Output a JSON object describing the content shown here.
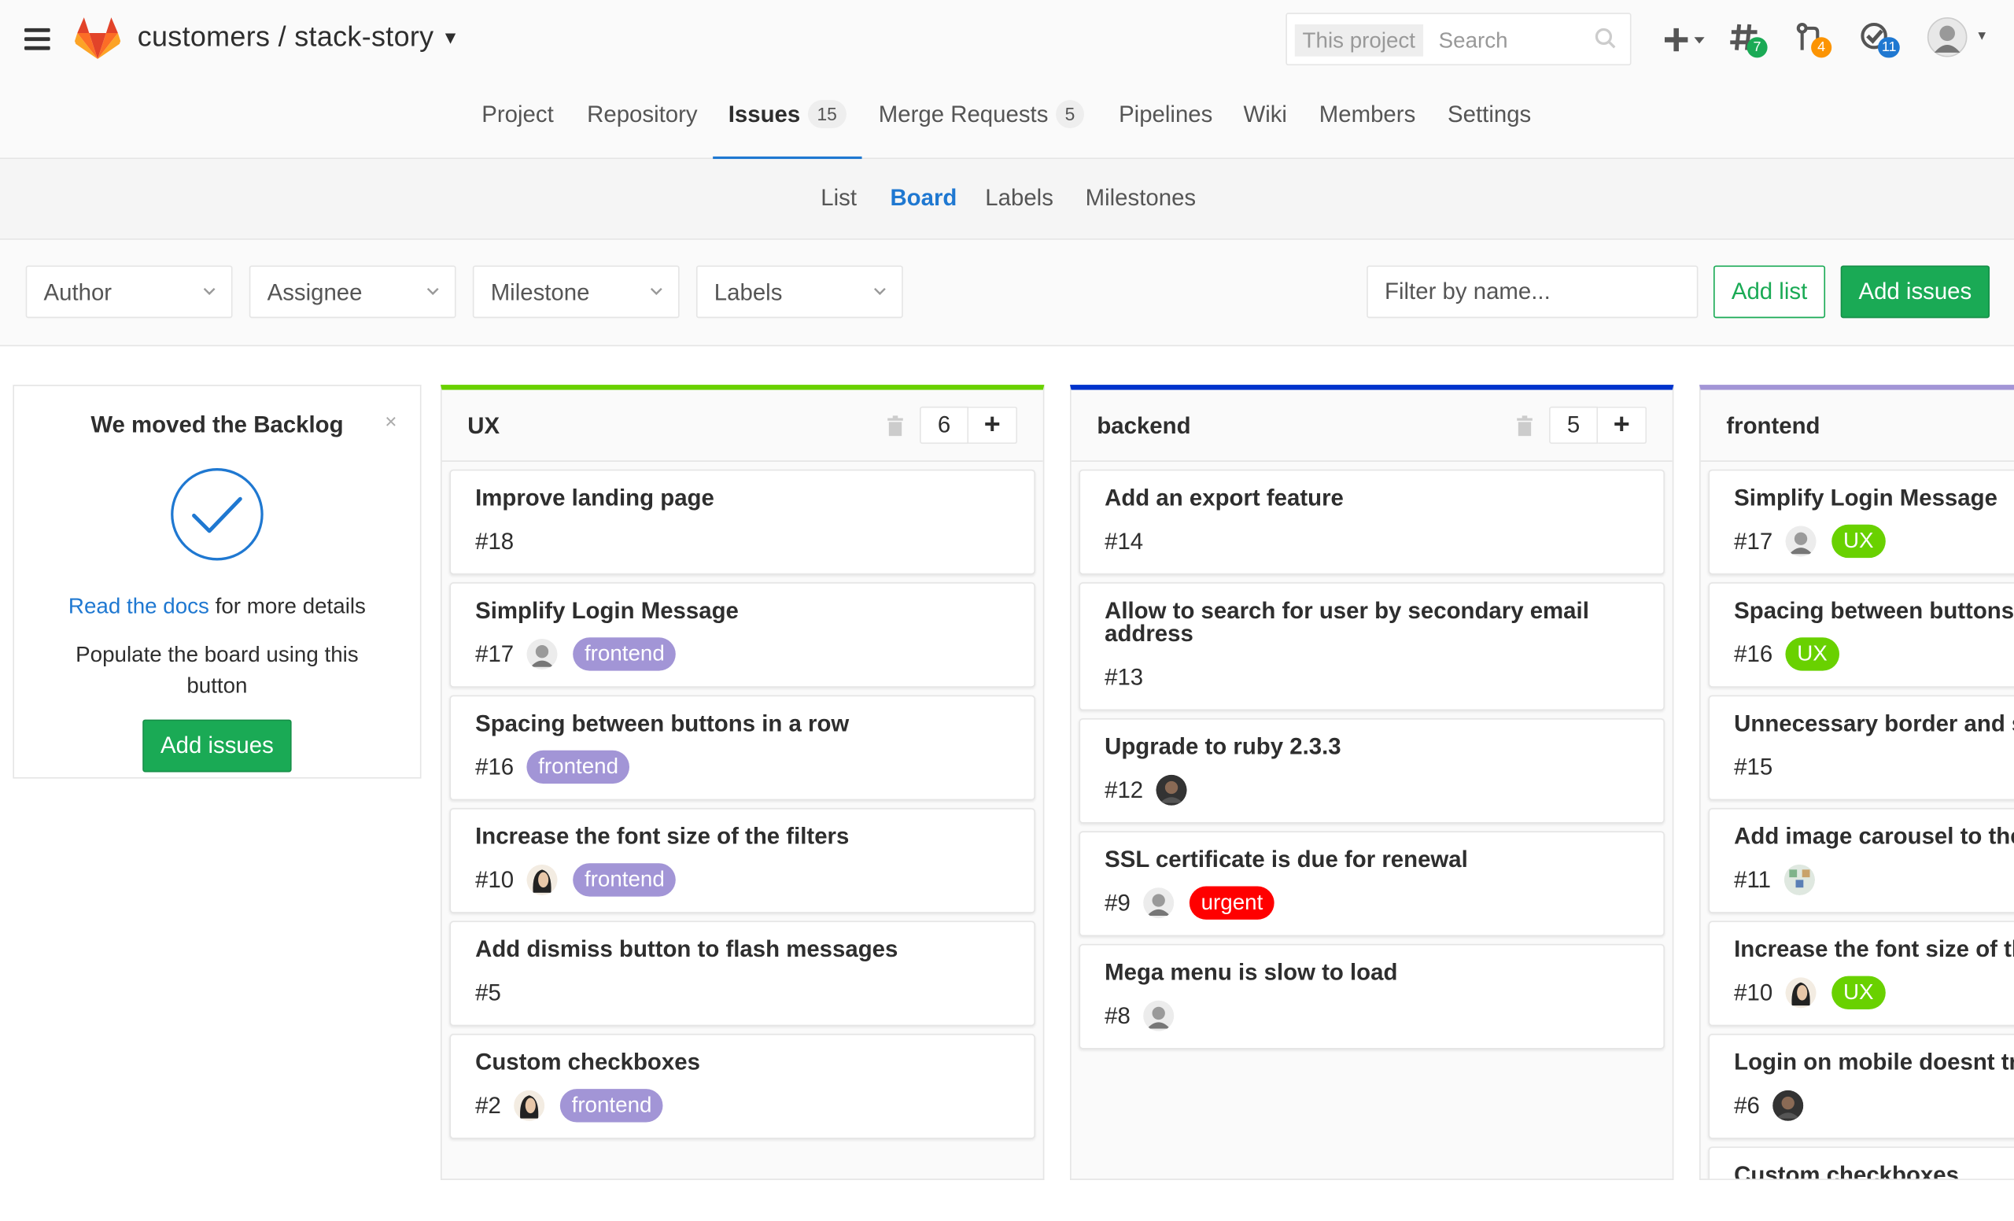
{
  "app": {
    "project_path": "customers / stack-story",
    "search": {
      "scope": "This project",
      "placeholder": "Search"
    },
    "badges": {
      "issues": "7",
      "merge_requests": "4",
      "todos": "11"
    }
  },
  "nav": {
    "items": [
      {
        "label": "Project"
      },
      {
        "label": "Repository"
      },
      {
        "label": "Issues",
        "count": "15"
      },
      {
        "label": "Merge Requests",
        "count": "5"
      },
      {
        "label": "Pipelines"
      },
      {
        "label": "Wiki"
      },
      {
        "label": "Members"
      },
      {
        "label": "Settings"
      }
    ],
    "active": "Issues"
  },
  "subnav": {
    "items": [
      "List",
      "Board",
      "Labels",
      "Milestones"
    ],
    "active": "Board"
  },
  "filters": {
    "author": "Author",
    "assignee": "Assignee",
    "milestone": "Milestone",
    "labels": "Labels",
    "name_placeholder": "Filter by name...",
    "add_list": "Add list",
    "add_issues": "Add issues"
  },
  "welcome": {
    "title": "We moved the Backlog",
    "dismiss": "×",
    "docs_link": "Read the docs",
    "docs_rest": " for more details",
    "populate": "Populate the board using this button",
    "button": "Add issues"
  },
  "colors": {
    "ux_list": "#69d100",
    "backend_list": "#0033cc",
    "frontend_list": "#a295d6",
    "label_frontend": "#a295d6",
    "label_ux": "#69d100",
    "label_urgent": "#ff0000",
    "accent": "#1f78d1",
    "success": "#1aaa55"
  },
  "lists": [
    {
      "title": "UX",
      "count": "6",
      "cards": [
        {
          "title": "Improve landing page",
          "number": "#18"
        },
        {
          "title": "Simplify Login Message",
          "number": "#17",
          "avatar": "grey",
          "label": "frontend"
        },
        {
          "title": "Spacing between buttons in a row",
          "number": "#16",
          "label": "frontend"
        },
        {
          "title": "Increase the font size of the filters",
          "number": "#10",
          "avatar": "woman",
          "label": "frontend"
        },
        {
          "title": "Add dismiss button to flash messages",
          "number": "#5"
        },
        {
          "title": "Custom checkboxes",
          "number": "#2",
          "avatar": "woman",
          "label": "frontend"
        }
      ]
    },
    {
      "title": "backend",
      "count": "5",
      "cards": [
        {
          "title": "Add an export feature",
          "number": "#14"
        },
        {
          "title": "Allow to search for user by secondary email address",
          "number": "#13"
        },
        {
          "title": "Upgrade to ruby 2.3.3",
          "number": "#12",
          "avatar": "dark"
        },
        {
          "title": "SSL certificate is due for renewal",
          "number": "#9",
          "avatar": "grey",
          "label": "urgent"
        },
        {
          "title": "Mega menu is slow to load",
          "number": "#8",
          "avatar": "grey"
        }
      ]
    },
    {
      "title": "frontend",
      "cards": [
        {
          "title": "Simplify Login Message",
          "number": "#17",
          "avatar": "grey",
          "label": "UX"
        },
        {
          "title": "Spacing between buttons",
          "number": "#16",
          "label": "UX"
        },
        {
          "title": "Unnecessary border and s",
          "number": "#15"
        },
        {
          "title": "Add image carousel to the",
          "number": "#11",
          "avatar": "pattern"
        },
        {
          "title": "Increase the font size of th",
          "number": "#10",
          "avatar": "woman",
          "label": "UX"
        },
        {
          "title": "Login on mobile doesnt tri",
          "number": "#6",
          "avatar": "dark"
        },
        {
          "title": "Custom checkboxes"
        }
      ]
    }
  ]
}
